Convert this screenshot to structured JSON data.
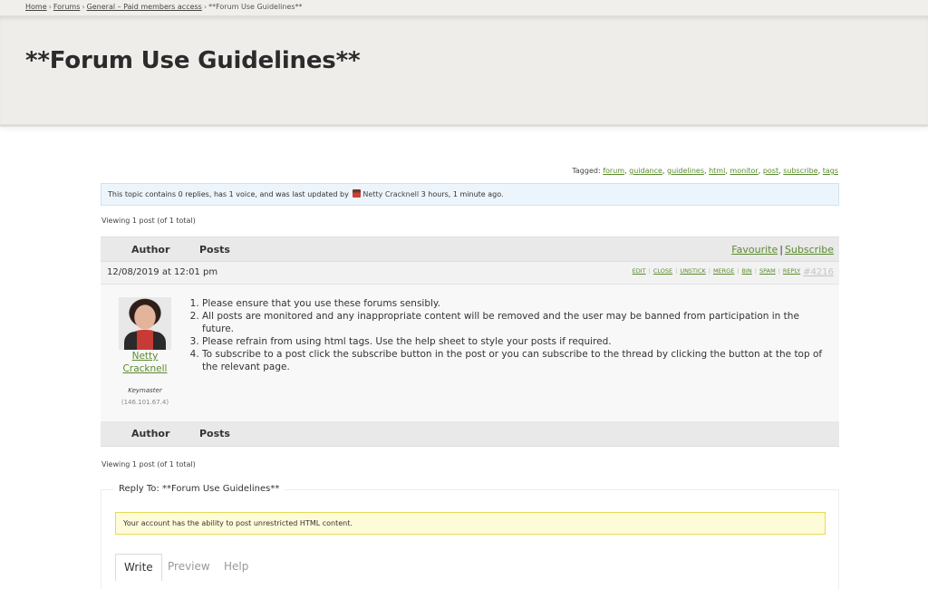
{
  "breadcrumb": {
    "items": [
      "Home",
      "Forums",
      "General – Paid members access"
    ],
    "current": "**Forum Use Guidelines**",
    "separator": "›"
  },
  "page": {
    "title": "**Forum Use Guidelines**"
  },
  "tags": {
    "label": "Tagged:",
    "items": [
      "forum",
      "guidance",
      "guidelines",
      "html",
      "monitor",
      "post",
      "subscribe",
      "tags"
    ]
  },
  "notice": {
    "prefix": "This topic contains 0 replies, has 1 voice, and was last updated by",
    "user": "Netty Cracknell",
    "suffix": "3 hours, 1 minute ago."
  },
  "viewing": {
    "top": "Viewing 1 post (of 1 total)",
    "bottom": "Viewing 1 post (of 1 total)"
  },
  "table": {
    "author_header": "Author",
    "posts_header": "Posts",
    "favourite": "Favourite",
    "subscribe": "Subscribe",
    "pipe": "|"
  },
  "post": {
    "date": "12/08/2019 at 12:01 pm",
    "admin_links": [
      "Edit",
      "Close",
      "Unstick",
      "Merge",
      "Bin",
      "Spam",
      "Reply"
    ],
    "permalink": "#4216",
    "author_first": "Netty",
    "author_last": "Cracknell",
    "author_role": "Keymaster",
    "author_ip": "(146.101.67.4)",
    "content": [
      "Please ensure that you use these forums sensibly.",
      "All posts are monitored and any inappropriate content will be removed and the user may be banned from participation in the future.",
      "Please refrain from using html tags. Use the help sheet to style your posts if required.",
      "To subscribe to a post click the subscribe button in the post or you can subscribe to the thread by clicking the button at the top of the relevant page."
    ]
  },
  "reply": {
    "legend": "Reply To: **Forum Use Guidelines**",
    "html_notice": "Your account has the ability to post unrestricted HTML content.",
    "tabs": [
      "Write",
      "Preview",
      "Help"
    ]
  }
}
